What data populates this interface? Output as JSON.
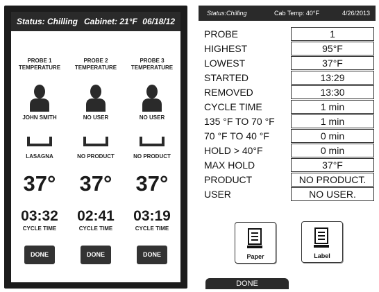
{
  "left": {
    "status": {
      "state": "Status: Chilling",
      "cabinet": "Cabinet: 21°F",
      "date": "06/18/12"
    },
    "probes": [
      {
        "title_line1": "PROBE 1",
        "title_line2": "TEMPERATURE",
        "user": "JOHN SMITH",
        "product": "LASAGNA",
        "temp": "37°",
        "time": "03:32",
        "cycle_label": "CYCLE TIME",
        "done_label": "DONE"
      },
      {
        "title_line1": "PROBE 2",
        "title_line2": "TEMPERATURE",
        "user": "NO USER",
        "product": "NO PRODUCT",
        "temp": "37°",
        "time": "02:41",
        "cycle_label": "CYCLE TIME",
        "done_label": "DONE"
      },
      {
        "title_line1": "PROBE 3",
        "title_line2": "TEMPERATURE",
        "user": "NO USER",
        "product": "NO PRODUCT",
        "temp": "37°",
        "time": "03:19",
        "cycle_label": "CYCLE TIME",
        "done_label": "DONE"
      }
    ],
    "icons": {
      "user": "user-silhouette-icon",
      "product": "product-tray-icon"
    }
  },
  "right": {
    "status": {
      "state": "Status:Chilling",
      "cabinet": "Cab Temp:  40°F",
      "date": "4/26/2013"
    },
    "rows": [
      {
        "label": "PROBE",
        "value": "1"
      },
      {
        "label": "HIGHEST",
        "value": "95°F"
      },
      {
        "label": "LOWEST",
        "value": "37°F"
      },
      {
        "label": "STARTED",
        "value": "13:29"
      },
      {
        "label": "REMOVED",
        "value": "13:30"
      },
      {
        "label": "CYCLE TIME",
        "value": "1 min"
      },
      {
        "label": "135 °F TO 70 °F",
        "value": "1 min"
      },
      {
        "label": "70 °F TO 40 °F",
        "value": "0 min"
      },
      {
        "label": "HOLD > 40°F",
        "value": "0 min"
      },
      {
        "label": "MAX HOLD",
        "value": "37°F"
      },
      {
        "label": "PRODUCT",
        "value": "NO PRODUCT."
      },
      {
        "label": "USER",
        "value": "NO USER."
      }
    ],
    "buttons": {
      "paper": "Paper",
      "label": "Label",
      "done": "DONE"
    },
    "icons": {
      "paper": "document-icon",
      "label": "label-icon"
    }
  },
  "colors": {
    "panel_dark": "#1c1c1c",
    "status_bar": "#2a2a2a",
    "button_dark": "#333333"
  }
}
